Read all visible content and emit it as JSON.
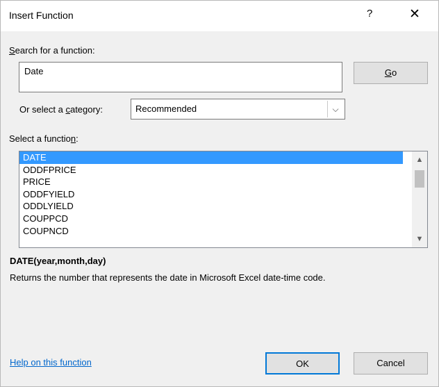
{
  "window": {
    "title": "Insert Function",
    "help_glyph": "?",
    "close_glyph": "✕"
  },
  "search": {
    "label_prefix": "",
    "label_ul": "S",
    "label_rest": "earch for a function:",
    "value": "Date",
    "go_ul": "G",
    "go_rest": "o"
  },
  "category": {
    "label_prefix": "Or select a ",
    "label_ul": "c",
    "label_rest": "ategory:",
    "selected": "Recommended",
    "arrow_glyph": "⌵"
  },
  "functions": {
    "label_prefix": "Select a functio",
    "label_ul": "n",
    "label_rest": ":",
    "items": [
      "DATE",
      "ODDFPRICE",
      "PRICE",
      "ODDFYIELD",
      "ODDLYIELD",
      "COUPPCD",
      "COUPNCD"
    ],
    "selected_index": 0,
    "scroll_up_glyph": "▲",
    "scroll_down_glyph": "▼"
  },
  "details": {
    "signature": "DATE(year,month,day)",
    "description": "Returns the number that represents the date in Microsoft Excel date-time code."
  },
  "footer": {
    "help_link": "Help on this function",
    "ok_label": "OK",
    "cancel_label": "Cancel"
  }
}
